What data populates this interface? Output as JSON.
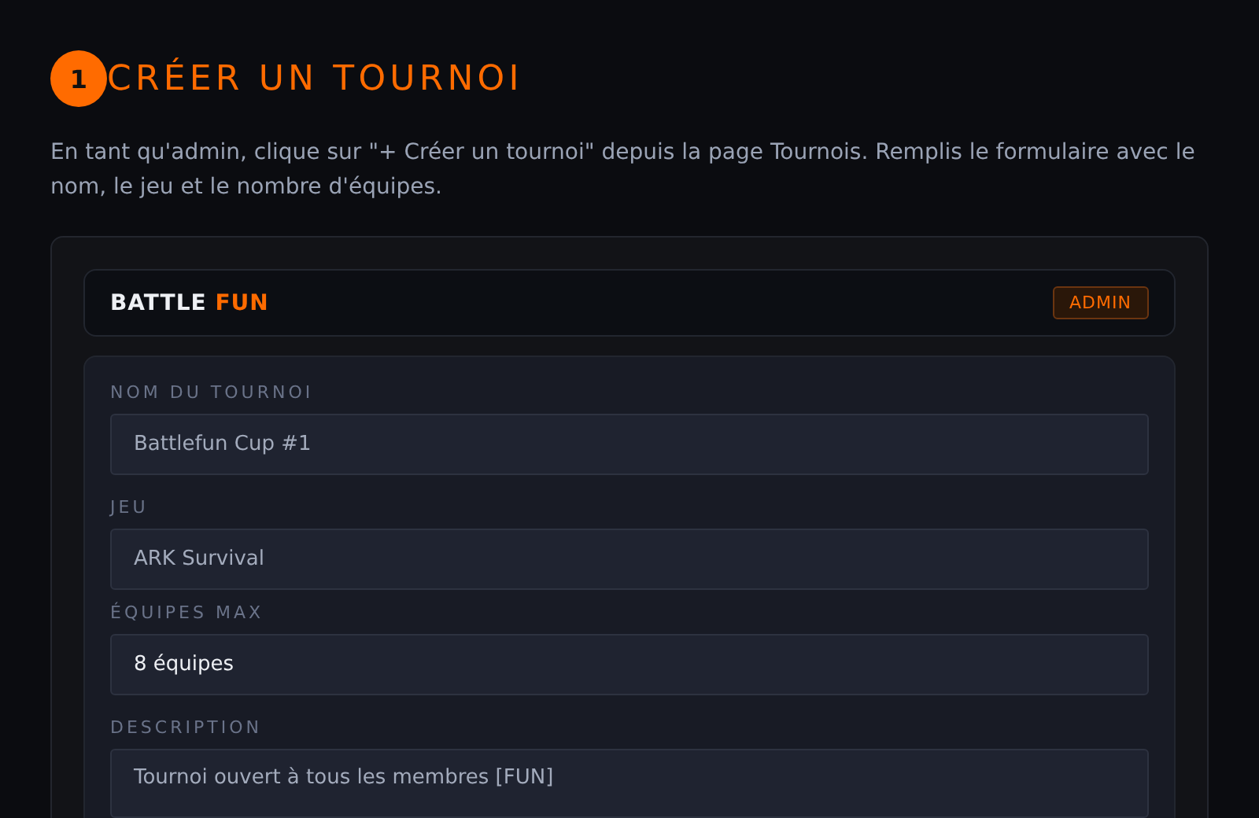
{
  "step": {
    "number": "1",
    "title": "CRÉER UN TOURNOI",
    "description": "En tant qu'admin, clique sur \"+ Créer un tournoi\" depuis la page Tournois. Remplis le formulaire avec le nom, le jeu et le nombre d'équipes."
  },
  "app_header": {
    "brand": "BATTLE",
    "brand_accent": "FUN",
    "badge": "ADMIN"
  },
  "form": {
    "fields": [
      {
        "label": "NOM DU TOURNOI",
        "kind": "text",
        "value": "Battlefun Cup #1"
      },
      {
        "label": "JEU",
        "kind": "text",
        "value": "ARK Survival"
      },
      {
        "label": "ÉQUIPES MAX",
        "kind": "select",
        "value": "8 équipes"
      },
      {
        "label": "DESCRIPTION",
        "kind": "textarea",
        "value": "Tournoi ouvert à tous les membres [FUN]"
      }
    ]
  }
}
